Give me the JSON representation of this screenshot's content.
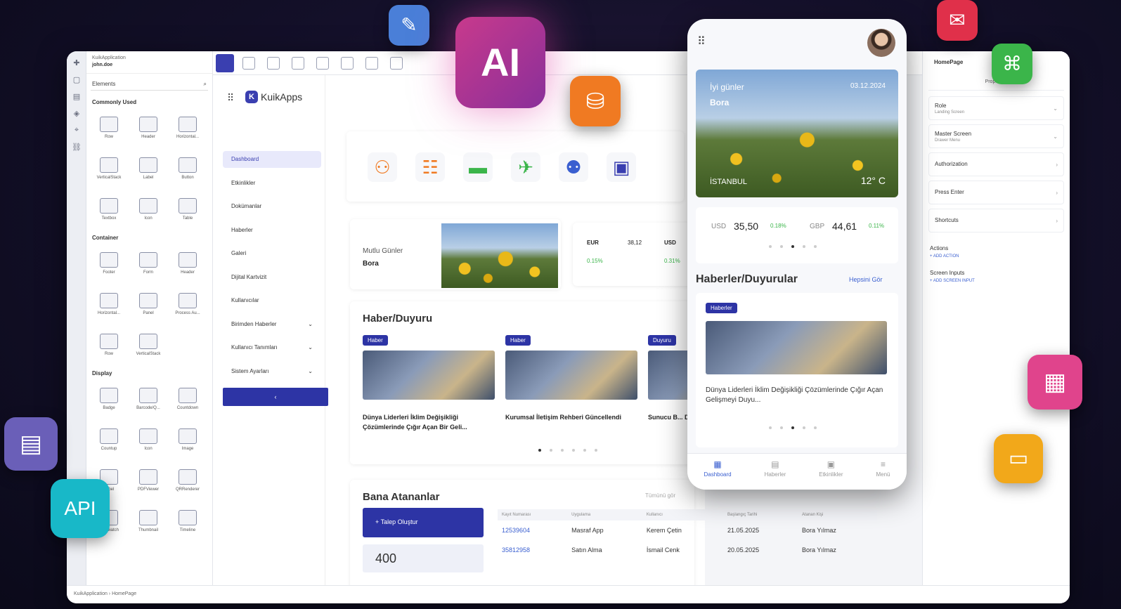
{
  "left_panel": {
    "app_name": "KuikApplication",
    "user": "john.doe",
    "search_label": "Elements",
    "sections": [
      {
        "title": "Commonly Used",
        "items": [
          "Row",
          "Header",
          "Horizontal...",
          "VerticalStack",
          "Label",
          "Button",
          "Textbox",
          "Icon",
          "Table"
        ]
      },
      {
        "title": "Container",
        "items": [
          "Footer",
          "Form",
          "Header",
          "Horizontal...",
          "Panel",
          "Process Au...",
          "Row",
          "VerticalStack"
        ]
      },
      {
        "title": "Display",
        "items": [
          "Badge",
          "Barcode/Q...",
          "Countdown",
          "Countup",
          "Icon",
          "Image",
          "Label",
          "PDFViewer",
          "QRRenderer",
          "Stopwatch",
          "Thumbnail",
          "Timeline"
        ]
      }
    ]
  },
  "canvas": {
    "brand": "KuikApps",
    "nav": [
      {
        "label": "Dashboard",
        "active": true
      },
      {
        "label": "Etkinlikler"
      },
      {
        "label": "Dokümanlar"
      },
      {
        "label": "Haberler"
      },
      {
        "label": "Galeri"
      },
      {
        "label": "Dijital Kartvizit"
      },
      {
        "label": "Kullanıcılar"
      },
      {
        "label": "Birimden Haberler",
        "chevron": true
      },
      {
        "label": "Kullanıcı Tanımları",
        "chevron": true
      },
      {
        "label": "Sistem Ayarları",
        "chevron": true
      }
    ],
    "nav_collapse": "‹",
    "welcome": {
      "greeting": "Mutlu Günler",
      "name": "Bora"
    },
    "currency": {
      "eur_label": "EUR",
      "eur_value": "38,12",
      "eur_change": "0.15%",
      "usd_label": "USD",
      "usd_change": "0.31%"
    },
    "news": {
      "title": "Haber/Duyuru",
      "items": [
        {
          "tag": "Haber",
          "caption": "Dünya Liderleri İklim Değişikliği Çözümlerinde Çığır Açan Bir Geli..."
        },
        {
          "tag": "Haber",
          "caption": "Kurumsal İletişim Rehberi Güncellendi"
        },
        {
          "tag": "Duyuru",
          "caption": "Sunucu B... Dolayısı..."
        }
      ]
    },
    "assigned": {
      "title": "Bana Atananlar",
      "button": "+ Talep Oluştur",
      "count": "400",
      "see_all": "Tümünü gör",
      "columns": [
        "Kayıt Numarası",
        "Uygulama",
        "Kullanıcı",
        "Başlangıç Tarihi",
        "Atanan Kişi"
      ],
      "rows": [
        [
          "12539604",
          "Masraf App",
          "Kerem Çetin",
          "21.05.2025",
          "Bora Yılmaz"
        ],
        [
          "35812958",
          "Satın Alma",
          "İsmail Cenk",
          "20.05.2025",
          "Bora Yılmaz"
        ]
      ]
    }
  },
  "phone": {
    "hero": {
      "greeting": "İyi günler",
      "name": "Bora",
      "date": "03.12.2024",
      "city": "İSTANBUL",
      "temp": "12° C"
    },
    "rates": [
      {
        "label": "USD",
        "value": "35,50",
        "change": "0.18%"
      },
      {
        "label": "GBP",
        "value": "44,61",
        "change": "0.11%"
      }
    ],
    "news_title": "Haberler/Duyurular",
    "news_link": "Hepsini Gör",
    "news_tag": "Haberler",
    "news_caption": "Dünya Liderleri İklim Değişikliği Çözümlerinde Çığır Açan Gelişmeyi Duyu...",
    "tabs": [
      "Dashboard",
      "Haberler",
      "Etkinlikler",
      "Menü"
    ]
  },
  "props": {
    "page": "HomePage",
    "tab": "Properties",
    "fields": [
      {
        "label": "Role",
        "sub": "Landing Screen"
      },
      {
        "label": "Master Screen",
        "sub": "Drawer Menu"
      },
      {
        "label": "Authorization",
        "sub": ""
      },
      {
        "label": "Press Enter",
        "sub": ""
      },
      {
        "label": "Shortcuts",
        "sub": ""
      }
    ],
    "actions_label": "Actions",
    "add_action": "+ ADD ACTION",
    "inputs_label": "Screen Inputs",
    "add_input": "+ ADD SCREEN INPUT"
  },
  "status_bar": {
    "breadcrumb": "KuikApplication  ›  HomePage"
  },
  "badges": {
    "ai": "AI",
    "api": "API"
  },
  "colors": {
    "accent": "#2d34a5",
    "ai_badge": "#b4308a",
    "orange": "#f07a22",
    "green": "#3bb54a",
    "red": "#e0304a",
    "pink": "#e0448c",
    "teal": "#18b8c8",
    "yellow": "#f2a81a",
    "purple": "#6a5fb8"
  }
}
